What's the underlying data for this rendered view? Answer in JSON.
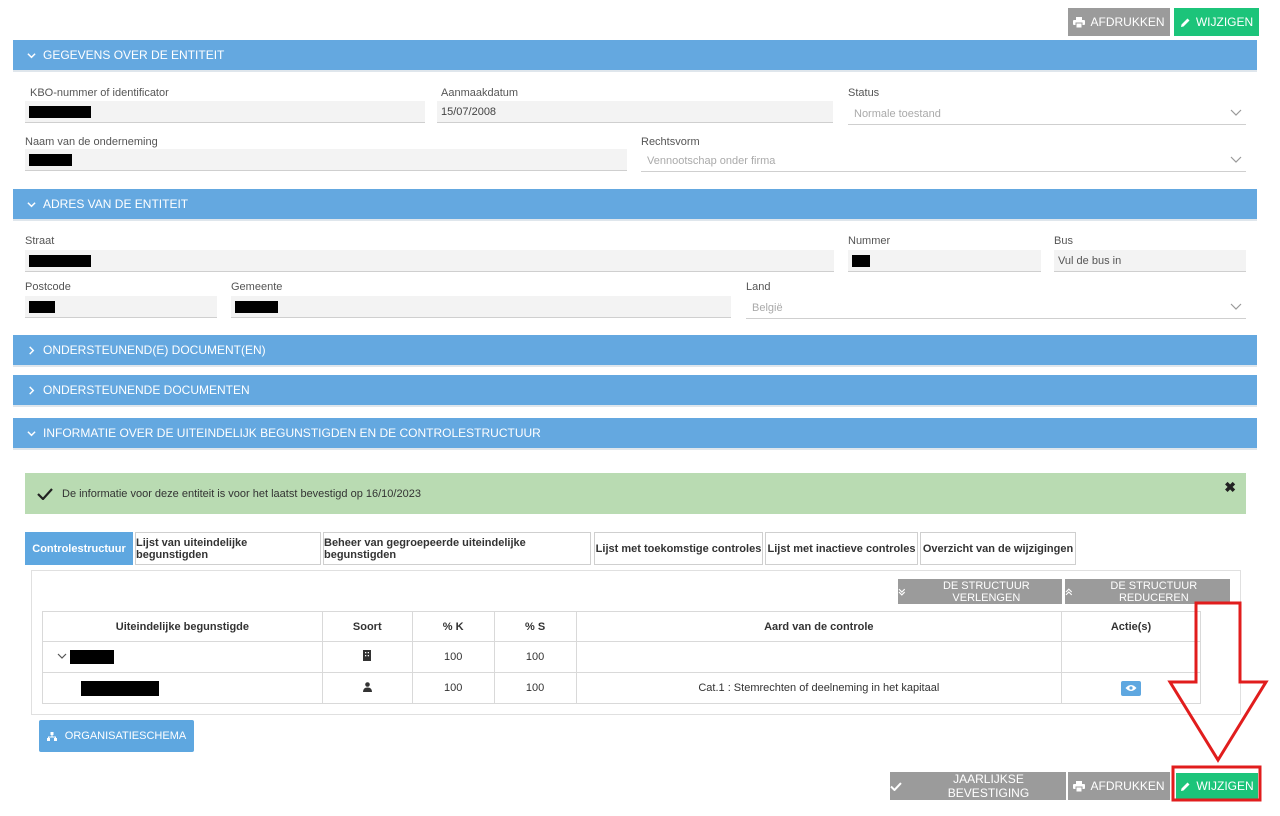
{
  "top_actions": {
    "print": "AFDRUKKEN",
    "edit": "WIJZIGEN"
  },
  "sections": {
    "entity_data": "GEGEVENS OVER DE ENTITEIT",
    "entity_address": "ADRES VAN DE ENTITEIT",
    "supporting_docs_1": "ONDERSTEUNEND(E) DOCUMENT(EN)",
    "supporting_docs_2": "ONDERSTEUNENDE DOCUMENTEN",
    "beneficiaries_info": "INFORMATIE OVER DE UITEINDELIJK BEGUNSTIGDEN EN DE CONTROLESTRUCTUUR"
  },
  "entity": {
    "kbo_label": "KBO-nummer of identificator",
    "created_label": "Aanmaakdatum",
    "created_value": "15/07/2008",
    "status_label": "Status",
    "status_value": "Normale toestand",
    "name_label": "Naam van de onderneming",
    "legal_form_label": "Rechtsvorm",
    "legal_form_value": "Vennootschap onder firma"
  },
  "address": {
    "street_label": "Straat",
    "number_label": "Nummer",
    "bus_label": "Bus",
    "bus_placeholder": "Vul de bus in",
    "postcode_label": "Postcode",
    "municipality_label": "Gemeente",
    "country_label": "Land",
    "country_value": "België"
  },
  "alert": {
    "text": "De informatie voor deze entiteit is voor het laatst bevestigd op 16/10/2023",
    "close": "✖"
  },
  "tabs": [
    "Controlestructuur",
    "Lijst van uiteindelijke begunstigden",
    "Beheer van gegroepeerde uiteindelijke begunstigden",
    "Lijst met toekomstige controles",
    "Lijst met inactieve controles",
    "Overzicht van de wijzigingen"
  ],
  "structure_actions": {
    "extend": "DE STRUCTUUR VERLENGEN",
    "reduce": "DE STRUCTUUR REDUCEREN"
  },
  "table": {
    "headers": [
      "Uiteindelijke begunstigde",
      "Soort",
      "% K",
      "% S",
      "Aard van de controle",
      "Actie(s)"
    ],
    "rows": [
      {
        "k": "100",
        "s": "100",
        "nature": ""
      },
      {
        "k": "100",
        "s": "100",
        "nature": "Cat.1 : Stemrechten of deelneming in het kapitaal"
      }
    ]
  },
  "org_chart_button": "ORGANISATIESCHEMA",
  "bottom_actions": {
    "annual_confirm": "JAARLIJKSE BEVESTIGING",
    "print": "AFDRUKKEN",
    "edit": "WIJZIGEN"
  },
  "colors": {
    "section": "#64a8e0",
    "green": "#1cc47a",
    "gray": "#9b9b9b",
    "alert_bg": "#b9dbb2",
    "annotation": "#e11d1d"
  }
}
